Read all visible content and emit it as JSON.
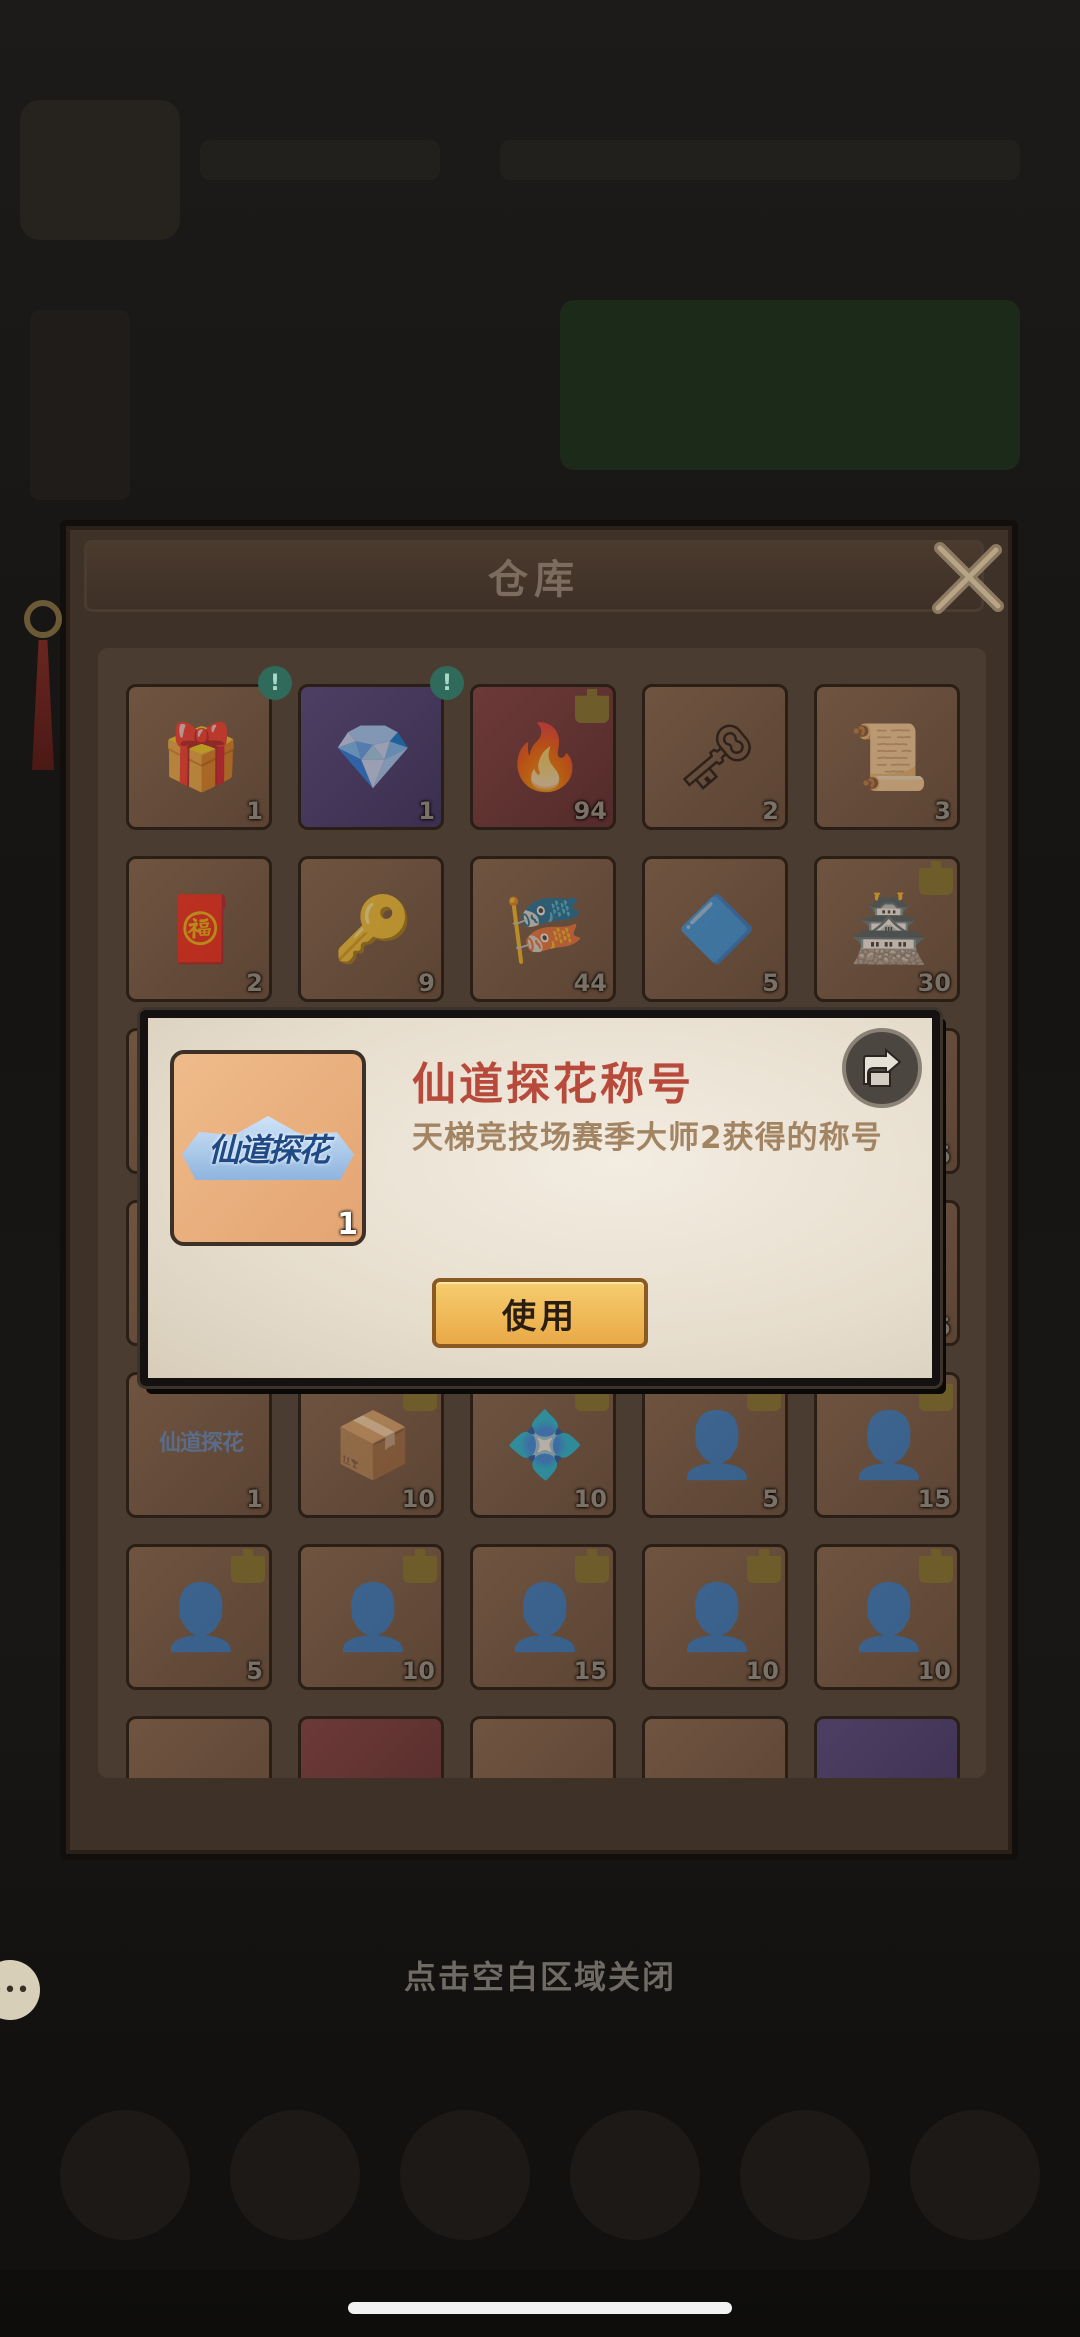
{
  "warehouse": {
    "title": "仓库",
    "close_hint": "点击空白区域关闭"
  },
  "popup": {
    "item_name": "仙道探花称号",
    "item_desc": "天梯竞技场赛季大师2获得的称号",
    "item_badge_text": "仙道探花",
    "item_count": "1",
    "use_label": "使用"
  },
  "slots": {
    "r1": [
      "1",
      "1",
      "94",
      "2",
      "3"
    ],
    "r2": [
      "2",
      "9",
      "44",
      "5",
      "30"
    ],
    "r3_right": [
      "5"
    ],
    "r4_right": [
      "5"
    ],
    "r5": [
      "1",
      "10",
      "10",
      "5",
      "15"
    ],
    "r6": [
      "5",
      "10",
      "15",
      "10",
      "10"
    ],
    "title_slot_text": "仙道探花"
  },
  "colors": {
    "title_red": "#b84a3b",
    "desc_tan": "#a28463",
    "use_button": "#e9a947"
  }
}
